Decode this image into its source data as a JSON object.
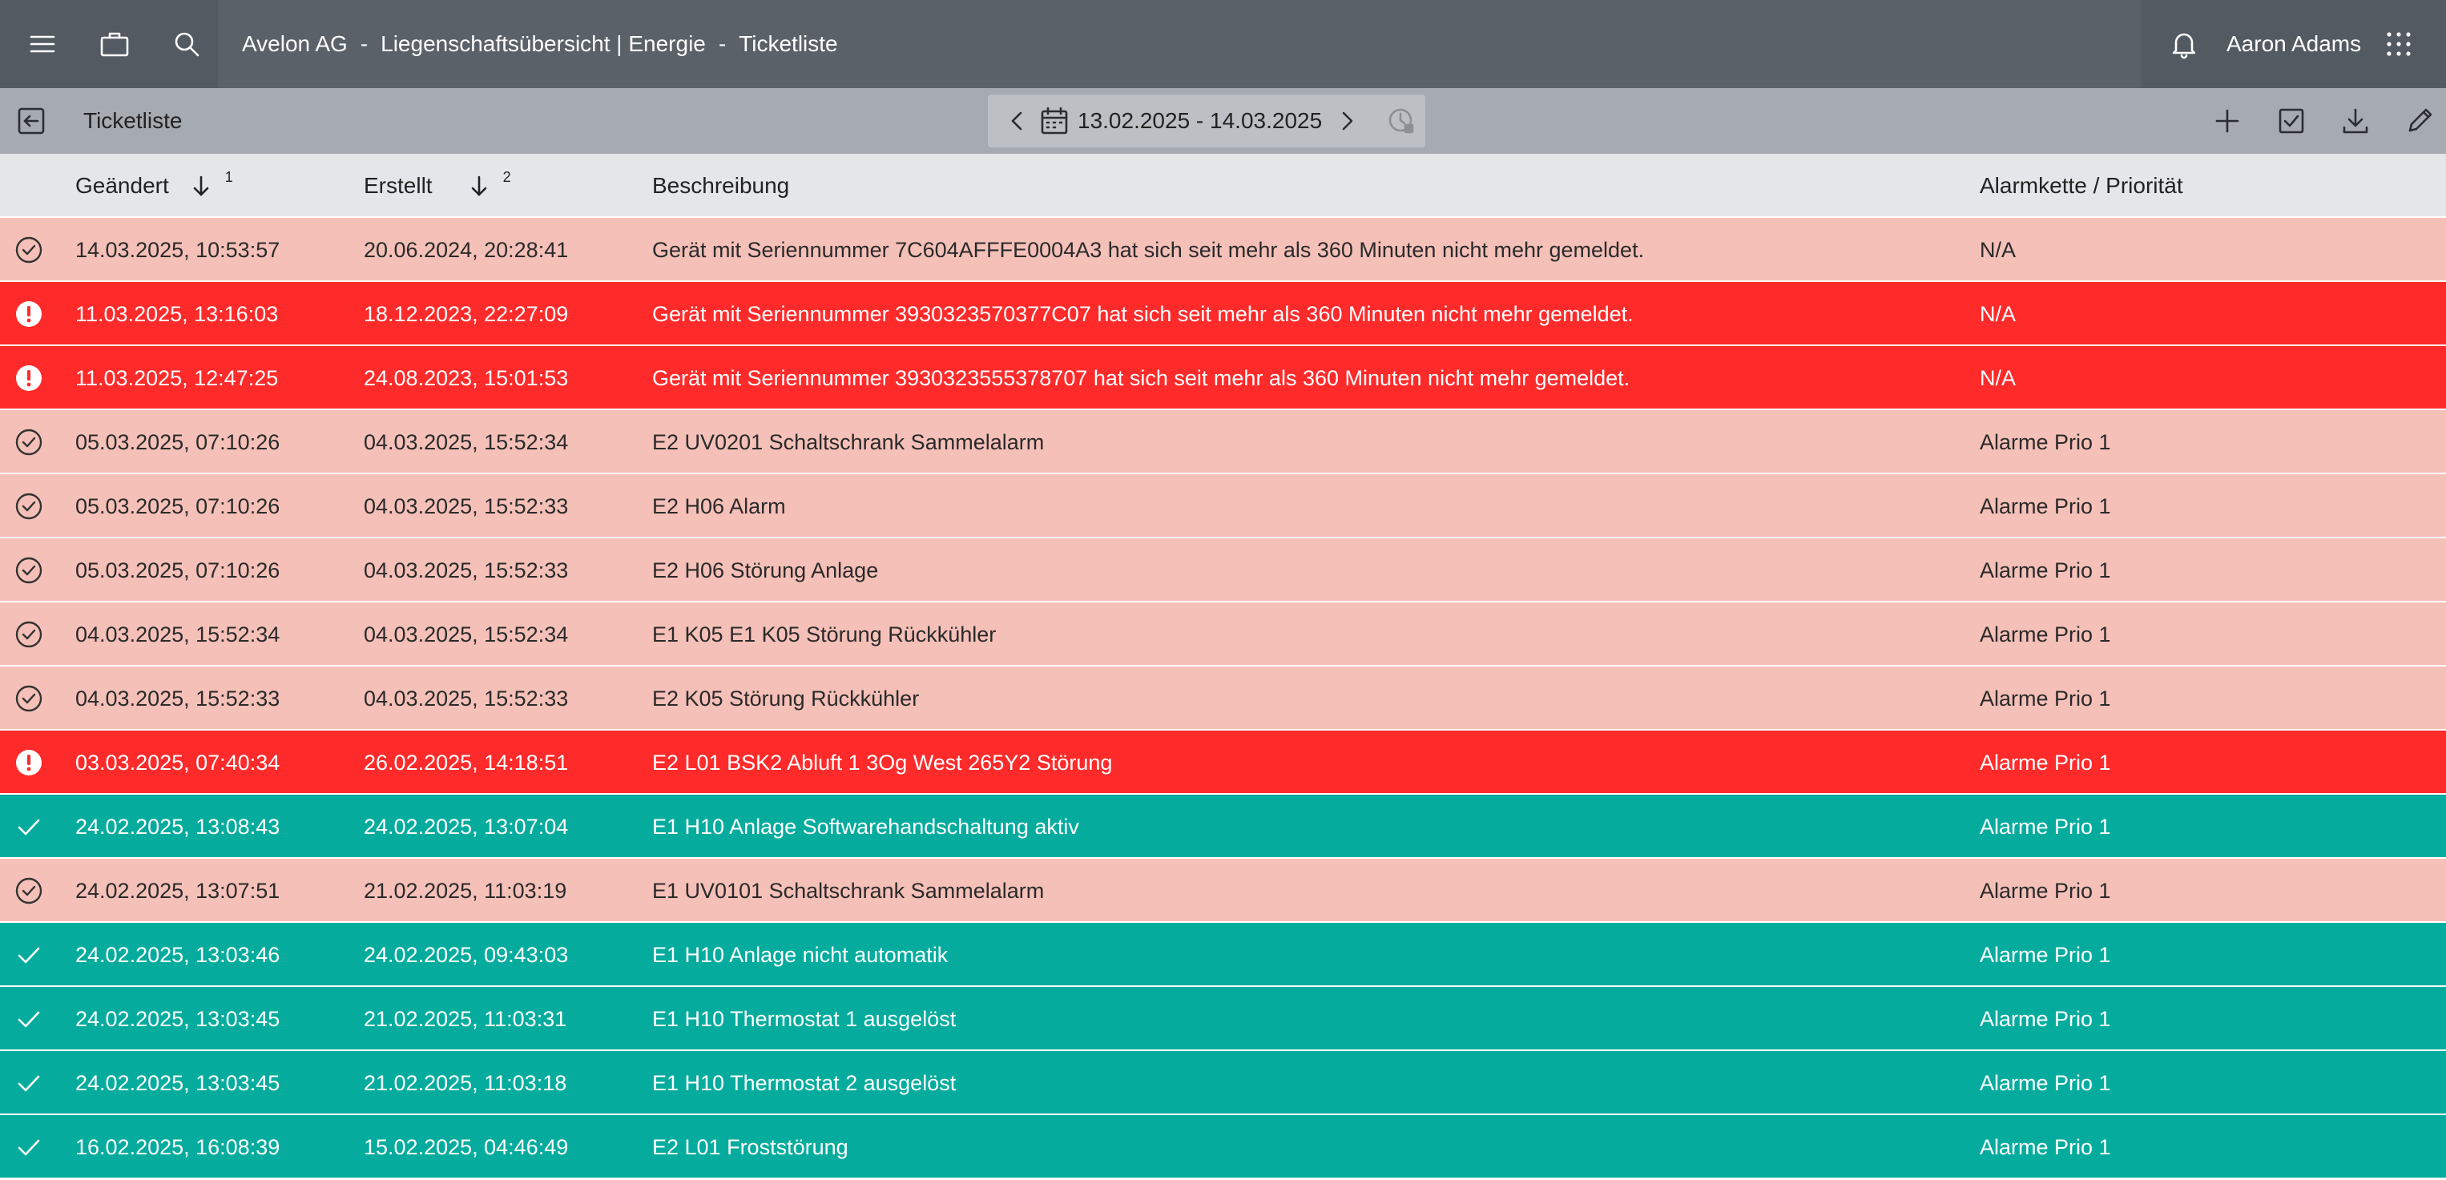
{
  "header": {
    "icons": [
      "menu-icon",
      "briefcase-icon",
      "search-icon"
    ],
    "breadcrumb": [
      "Avelon AG",
      "Liegenschaftsübersicht | Energie",
      "Ticketliste"
    ],
    "separator": "-",
    "user_name": "Aaron Adams",
    "right_icons": [
      "bell-icon",
      "apps-grid-icon"
    ]
  },
  "toolbar": {
    "title": "Ticketliste",
    "date_range": "13.02.2025 - 14.03.2025",
    "actions": [
      "add-icon",
      "checkbox-icon",
      "download-icon",
      "edit-icon"
    ]
  },
  "table": {
    "columns": {
      "modified": "Geändert",
      "modified_sort": "1",
      "created": "Erstellt",
      "created_sort": "2",
      "description": "Beschreibung",
      "priority": "Alarmkette / Priorität"
    },
    "rows": [
      {
        "status": "acknowledged",
        "modified": "14.03.2025, 10:53:57",
        "created": "20.06.2024, 20:28:41",
        "description": "Gerät mit Seriennummer 7C604AFFFE0004A3 hat sich seit mehr als 360 Minuten nicht mehr gemeldet.",
        "priority": "N/A"
      },
      {
        "status": "active",
        "modified": "11.03.2025, 13:16:03",
        "created": "18.12.2023, 22:27:09",
        "description": "Gerät mit Seriennummer 3930323570377C07 hat sich seit mehr als 360 Minuten nicht mehr gemeldet.",
        "priority": "N/A"
      },
      {
        "status": "active",
        "modified": "11.03.2025, 12:47:25",
        "created": "24.08.2023, 15:01:53",
        "description": "Gerät mit Seriennummer 3930323555378707 hat sich seit mehr als 360 Minuten nicht mehr gemeldet.",
        "priority": "N/A"
      },
      {
        "status": "acknowledged",
        "modified": "05.03.2025, 07:10:26",
        "created": "04.03.2025, 15:52:34",
        "description": "E2 UV0201 Schaltschrank Sammelalarm",
        "priority": "Alarme Prio 1"
      },
      {
        "status": "acknowledged",
        "modified": "05.03.2025, 07:10:26",
        "created": "04.03.2025, 15:52:33",
        "description": "E2 H06 Alarm",
        "priority": "Alarme Prio 1"
      },
      {
        "status": "acknowledged",
        "modified": "05.03.2025, 07:10:26",
        "created": "04.03.2025, 15:52:33",
        "description": "E2 H06 Störung Anlage",
        "priority": "Alarme Prio 1"
      },
      {
        "status": "acknowledged",
        "modified": "04.03.2025, 15:52:34",
        "created": "04.03.2025, 15:52:34",
        "description": "E1 K05 E1 K05 Störung Rückkühler",
        "priority": "Alarme Prio 1"
      },
      {
        "status": "acknowledged",
        "modified": "04.03.2025, 15:52:33",
        "created": "04.03.2025, 15:52:33",
        "description": "E2 K05 Störung Rückkühler",
        "priority": "Alarme Prio 1"
      },
      {
        "status": "active",
        "modified": "03.03.2025, 07:40:34",
        "created": "26.02.2025, 14:18:51",
        "description": "E2 L01 BSK2 Abluft 1 3Og West 265Y2 Störung",
        "priority": "Alarme Prio 1"
      },
      {
        "status": "resolved",
        "modified": "24.02.2025, 13:08:43",
        "created": "24.02.2025, 13:07:04",
        "description": "E1 H10 Anlage Softwarehandschaltung aktiv",
        "priority": "Alarme Prio 1"
      },
      {
        "status": "acknowledged",
        "modified": "24.02.2025, 13:07:51",
        "created": "21.02.2025, 11:03:19",
        "description": "E1 UV0101 Schaltschrank Sammelalarm",
        "priority": "Alarme Prio 1"
      },
      {
        "status": "resolved",
        "modified": "24.02.2025, 13:03:46",
        "created": "24.02.2025, 09:43:03",
        "description": "E1 H10 Anlage nicht automatik",
        "priority": "Alarme Prio 1"
      },
      {
        "status": "resolved",
        "modified": "24.02.2025, 13:03:45",
        "created": "21.02.2025, 11:03:31",
        "description": "E1 H10 Thermostat 1 ausgelöst",
        "priority": "Alarme Prio 1"
      },
      {
        "status": "resolved",
        "modified": "24.02.2025, 13:03:45",
        "created": "21.02.2025, 11:03:18",
        "description": "E1 H10 Thermostat 2 ausgelöst",
        "priority": "Alarme Prio 1"
      },
      {
        "status": "resolved",
        "modified": "16.02.2025, 16:08:39",
        "created": "15.02.2025, 04:46:49",
        "description": "E2 L01 Froststörung",
        "priority": "Alarme Prio 1"
      }
    ]
  },
  "colors": {
    "header_bg": "#5b6169",
    "toolbar_bg": "#a6aab1",
    "acknowledged_row": "#f5c0b8",
    "active_row": "#ff2a2a",
    "resolved_row": "#05ac9e"
  }
}
